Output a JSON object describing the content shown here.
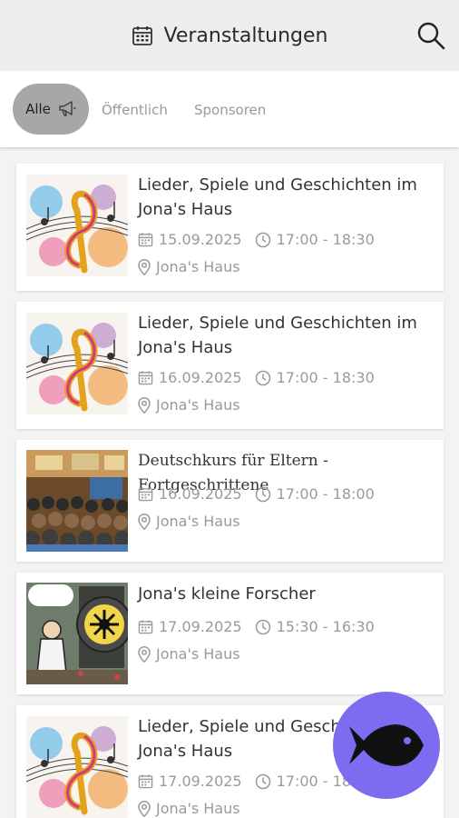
{
  "header": {
    "title": "Veranstaltungen",
    "calendar_icon": "calendar-icon",
    "search_icon": "search-icon"
  },
  "filters": {
    "active": {
      "label": "Alle",
      "icon": "megaphone-icon"
    },
    "public_label": "Öffentlich",
    "sponsors_label": "Sponsoren"
  },
  "events": [
    {
      "title": "Lieder, Spiele und Geschichten im Jona's Haus",
      "date": "15.09.2025",
      "time": "17:00 - 18:30",
      "location": "Jona's Haus",
      "image": "treble-clef-art"
    },
    {
      "title": "Lieder, Spiele und Geschichten im Jona's Haus",
      "date": "16.09.2025",
      "time": "17:00 - 18:30",
      "location": "Jona's Haus",
      "image": "treble-clef-art"
    },
    {
      "title": "Deutschkurs für Eltern - Fortgeschrittene",
      "date": "16.09.2025",
      "time": "17:00 - 18:00",
      "location": "Jona's Haus",
      "image": "conference-hall-photo"
    },
    {
      "title": "Jona's kleine Forscher",
      "date": "17.09.2025",
      "time": "15:30 - 16:30",
      "location": "Jona's Haus",
      "image": "scientist-cartoon"
    },
    {
      "title": "Lieder, Spiele und Geschichten im Jona's Haus",
      "date": "17.09.2025",
      "time": "17:00 - 18:30",
      "location": "Jona's Haus",
      "image": "treble-clef-art"
    }
  ],
  "fab": {
    "icon": "fish-icon"
  },
  "colors": {
    "fab": "#7b6cf0",
    "chip_active": "#a7a7a7",
    "header_bg": "#eeeeee"
  }
}
